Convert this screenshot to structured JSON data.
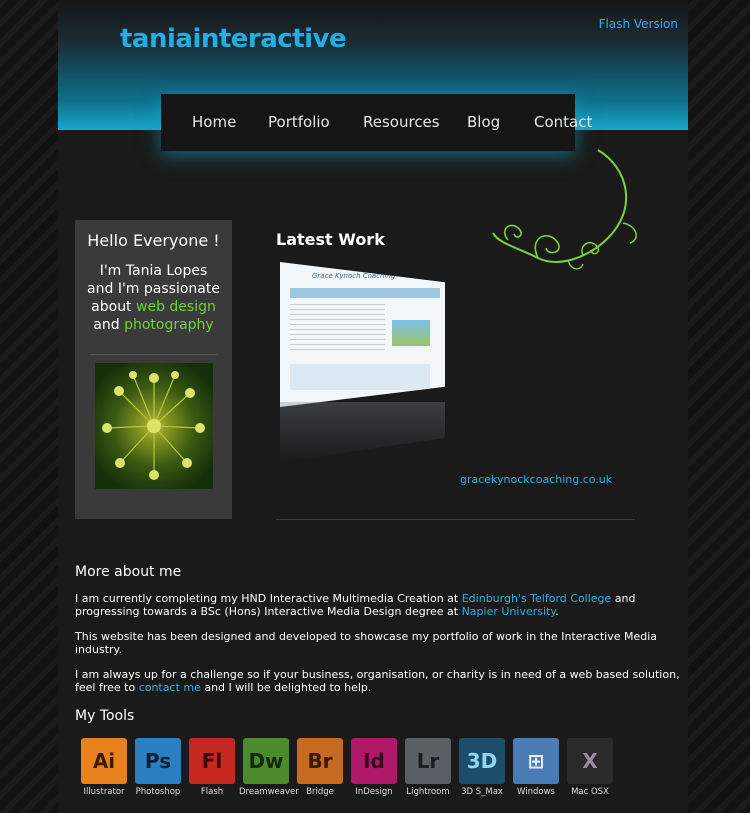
{
  "header": {
    "logo": "taniainteractive",
    "flash_link": "Flash Version"
  },
  "nav": {
    "items": [
      {
        "label": "Home"
      },
      {
        "label": "Portfolio"
      },
      {
        "label": "Resources"
      },
      {
        "label": "Blog"
      },
      {
        "label": "Contact"
      }
    ]
  },
  "hello": {
    "title": "Hello Everyone !",
    "line1": "I'm Tania Lopes",
    "line2": "and I'm passionate",
    "line3_prefix": "about ",
    "line3_link": "web design",
    "line4_prefix": "and ",
    "line4_link": "photography"
  },
  "latest_work": {
    "title": "Latest Work",
    "thumb_brand": "Grace Kynoch Coaching",
    "link": "gracekynockcoaching.co.uk"
  },
  "about": {
    "title": "More about me",
    "p1_a": "I am currently completing my HND Interactive Multimedia Creation at ",
    "p1_link1": "Edinburgh's Telford College",
    "p1_b": " and progressing towards a BSc (Hons) Interactive Media Design degree at ",
    "p1_link2": "Napier University",
    "p1_c": ".",
    "p2": "This website has been designed and developed to showcase my portfolio of work in the Interactive Media industry.",
    "p3_a": "I am always up for a challenge so if your business, organisation, or charity is in need of a web based solution, feel free to ",
    "p3_link": "contact me",
    "p3_b": " and I will be delighted to help."
  },
  "tools": {
    "title": "My Tools",
    "items": [
      {
        "abbr": "Ai",
        "label": "Illustrator",
        "bg": "#e8821e",
        "fg": "#3b1c00"
      },
      {
        "abbr": "Ps",
        "label": "Photoshop",
        "bg": "#2a7fc0",
        "fg": "#0b1f3a"
      },
      {
        "abbr": "Fl",
        "label": "Flash",
        "bg": "#c5281f",
        "fg": "#3a0807"
      },
      {
        "abbr": "Dw",
        "label": "Dreamweaver",
        "bg": "#4c8a2c",
        "fg": "#12290a"
      },
      {
        "abbr": "Br",
        "label": "Bridge",
        "bg": "#c56a20",
        "fg": "#3a1a05"
      },
      {
        "abbr": "Id",
        "label": "InDesign",
        "bg": "#b0186a",
        "fg": "#36051f"
      },
      {
        "abbr": "Lr",
        "label": "Lightroom",
        "bg": "#5a5f66",
        "fg": "#1a1c20"
      },
      {
        "abbr": "3D",
        "label": "3D S_Max",
        "bg": "#1c4e6b",
        "fg": "#8ed8f0"
      },
      {
        "abbr": "⊞",
        "label": "Windows",
        "bg": "#4a7db5",
        "fg": "#e8f0ff"
      },
      {
        "abbr": "X",
        "label": "Mac OSX",
        "bg": "#2a2a2a",
        "fg": "#9a8aa8"
      }
    ]
  },
  "colors": {
    "accent_blue": "#2cb0e4",
    "accent_green": "#6fd13c"
  }
}
